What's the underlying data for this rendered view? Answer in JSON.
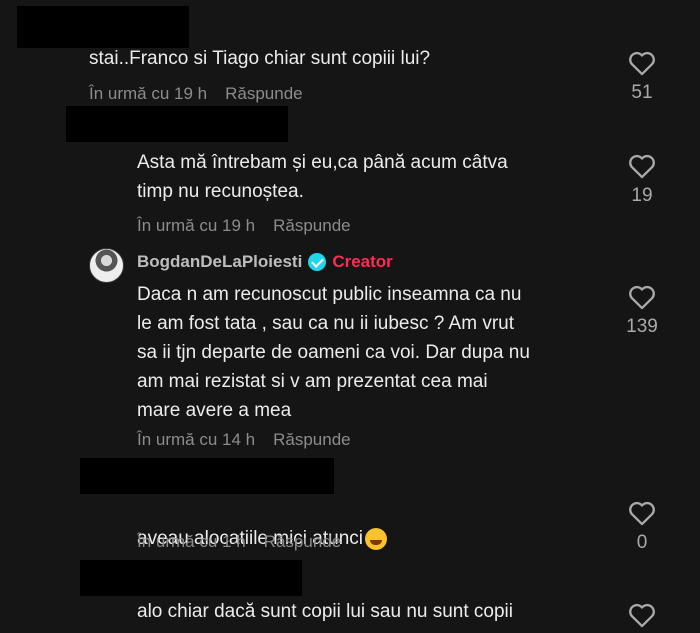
{
  "comments": [
    {
      "text": "stai..Franco si Tiago chiar sunt copiii lui?",
      "time": "În urmă cu 19 h",
      "reply": "Răspunde",
      "likes": "51"
    },
    {
      "text": "Asta mă întrebam și eu,ca până acum câtva\ntimp nu recunoștea.",
      "time": "În urmă cu 19 h",
      "reply": "Răspunde",
      "likes": "19"
    },
    {
      "author": "BogdanDeLaPloiesti",
      "badge": "Creator",
      "text": "Daca n am recunoscut public inseamna ca nu\nle am fost tata , sau ca nu ii iubesc ? Am vrut\nsa ii tjn departe de oameni ca voi. Dar dupa nu\nam mai rezistat si v am prezentat cea mai\nmare avere a mea",
      "time": "În urmă cu 14 h",
      "reply": "Răspunde",
      "likes": "139"
    },
    {
      "text": "aveau alocatiile mici atunci",
      "emoji": "sweat-smile-emoji",
      "time": "În urmă cu 1 h",
      "reply": "Răspunde",
      "likes": "0"
    },
    {
      "text": "alo chiar dacă sunt copii lui sau nu sunt copii"
    }
  ],
  "colors": {
    "background": "#151515",
    "text": "#ececec",
    "meta": "#8c8c8c",
    "creator": "#fe2c55",
    "verified": "#20d5ec"
  }
}
